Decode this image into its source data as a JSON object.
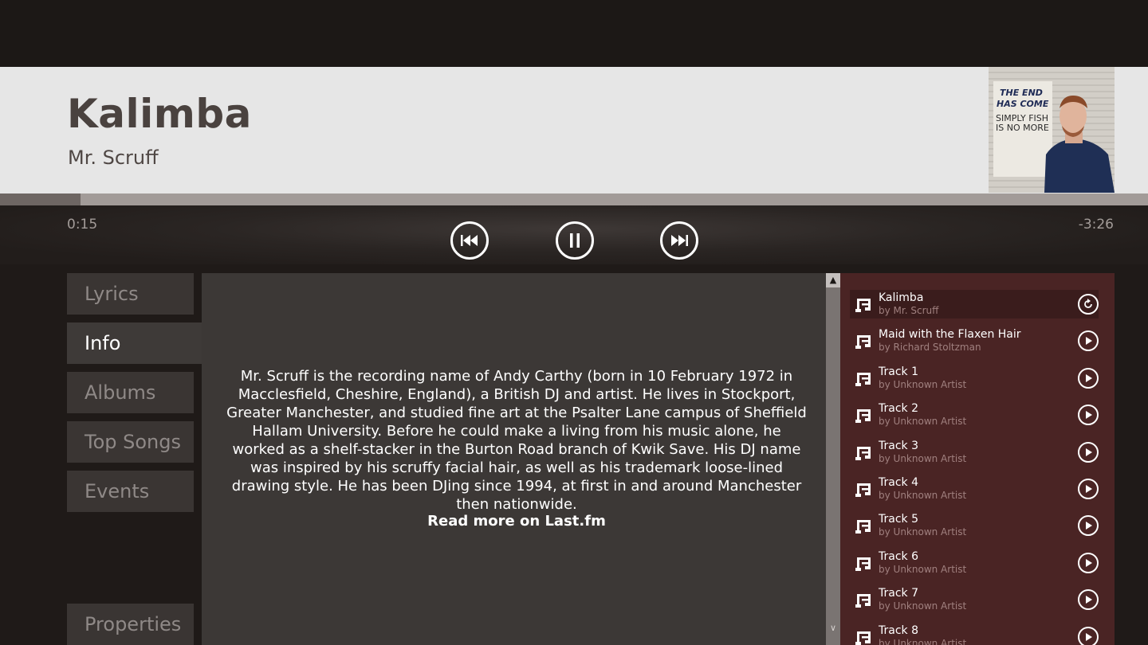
{
  "now_playing": {
    "title": "Kalimba",
    "artist": "Mr. Scruff",
    "elapsed": "0:15",
    "remaining": "-3:26",
    "progress_fraction": 0.07
  },
  "controls": {
    "previous_icon": "skip-previous-icon",
    "pause_icon": "pause-icon",
    "next_icon": "skip-next-icon"
  },
  "tabs": [
    "Lyrics",
    "Info",
    "Albums",
    "Top Songs",
    "Events"
  ],
  "active_tab": "Info",
  "properties_label": "Properties",
  "info": {
    "bio": "Mr. Scruff is the recording name of Andy Carthy (born in 10 February 1972 in Macclesfield, Cheshire, England), a British DJ and artist. He lives in Stockport, Greater Manchester, and studied fine art at the Psalter Lane campus of Sheffield Hallam University. Before he could make a living from his music alone, he worked as a shelf-stacker in the Burton Road branch of Kwik Save. His DJ name was inspired by his scruffy facial hair, as well as his trademark loose-lined drawing style. He has been DJing since 1994, at first in and around Manchester then nationwide.",
    "read_more": "Read more on Last.fm"
  },
  "playlist": [
    {
      "name": "Kalimba",
      "artist": "by Mr. Scruff",
      "current": true
    },
    {
      "name": "Maid with the Flaxen Hair",
      "artist": "by Richard Stoltzman"
    },
    {
      "name": "Track 1",
      "artist": "by Unknown Artist"
    },
    {
      "name": "Track 2",
      "artist": "by Unknown Artist"
    },
    {
      "name": "Track 3",
      "artist": "by Unknown Artist"
    },
    {
      "name": "Track 4",
      "artist": "by Unknown Artist"
    },
    {
      "name": "Track 5",
      "artist": "by Unknown Artist"
    },
    {
      "name": "Track 6",
      "artist": "by Unknown Artist"
    },
    {
      "name": "Track 7",
      "artist": "by Unknown Artist"
    },
    {
      "name": "Track 8",
      "artist": "by Unknown Artist"
    }
  ],
  "album_art": {
    "sign_text": "THE END HAS COME SIMPLY FISH IS NO MORE"
  },
  "colors": {
    "header_bg": "#e6e6e6",
    "title_color": "#4a423f",
    "playlist_bg": "#4a2424",
    "panel_bg": "#3c3836"
  }
}
